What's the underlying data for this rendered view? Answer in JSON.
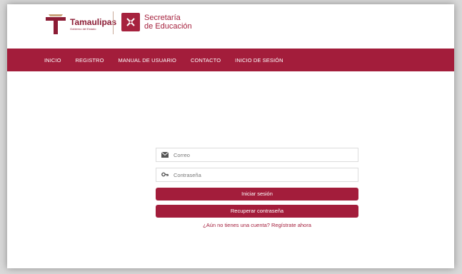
{
  "brand": {
    "name": "Tamaulipas",
    "tagline": "Gobierno del Estado",
    "secretaria_line1": "Secretaría",
    "secretaria_line2": "de Educación"
  },
  "nav": {
    "items": [
      {
        "label": "INICIO"
      },
      {
        "label": "REGISTRO"
      },
      {
        "label": "MANUAL DE USUARIO"
      },
      {
        "label": "CONTACTO"
      },
      {
        "label": "INICIO DE SESIÓN"
      }
    ]
  },
  "login": {
    "email_placeholder": "Correo",
    "email_value": "",
    "password_placeholder": "Contraseña",
    "password_value": "",
    "login_button": "Iniciar sesión",
    "recover_button": "Recuperar contraseña",
    "register_link": "¿Aún no tienes una cuenta? Regístrate ahora"
  },
  "icons": {
    "email": "envelope-icon",
    "password": "key-icon",
    "brand": "t-logo-icon",
    "secretaria": "pencil-cross-icon"
  },
  "colors": {
    "primary": "#a31d3b",
    "brand_text": "#8c1c35",
    "background": "#ffffff"
  }
}
